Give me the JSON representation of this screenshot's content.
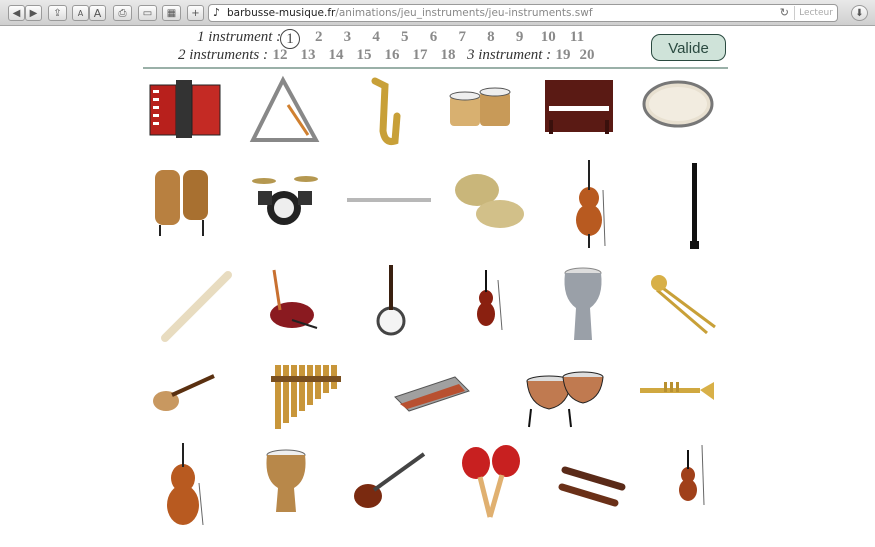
{
  "browser": {
    "url_domain": "barbusse-musique.fr",
    "url_path": "/animations/jeu_instruments/jeu-instruments.swf",
    "reader_label": "Lecteur"
  },
  "header": {
    "label_1": "1 instrument :",
    "label_2": "2 instruments :",
    "label_3": "3 instrument :",
    "numbers_1": [
      "1",
      "2",
      "3",
      "4",
      "5",
      "6",
      "7",
      "8",
      "9",
      "10",
      "11"
    ],
    "numbers_2": [
      "12",
      "13",
      "14",
      "15",
      "16",
      "17",
      "18"
    ],
    "numbers_3": [
      "19",
      "20"
    ],
    "selected": "1",
    "valide_label": "Valide"
  },
  "instruments": [
    "accordion",
    "triangle",
    "saxophone",
    "bongos",
    "piano",
    "tambourine",
    "congas",
    "drum-kit",
    "flute",
    "cymbals",
    "cello",
    "clarinet",
    "recorder",
    "bagpipes",
    "banjo",
    "violin",
    "darbuka",
    "trombone",
    "ukulele",
    "pan-flute",
    "harmonica",
    "timpani",
    "trumpet",
    "double-bass",
    "djembe",
    "electric-guitar",
    "maracas",
    "claves",
    "violin-small"
  ]
}
